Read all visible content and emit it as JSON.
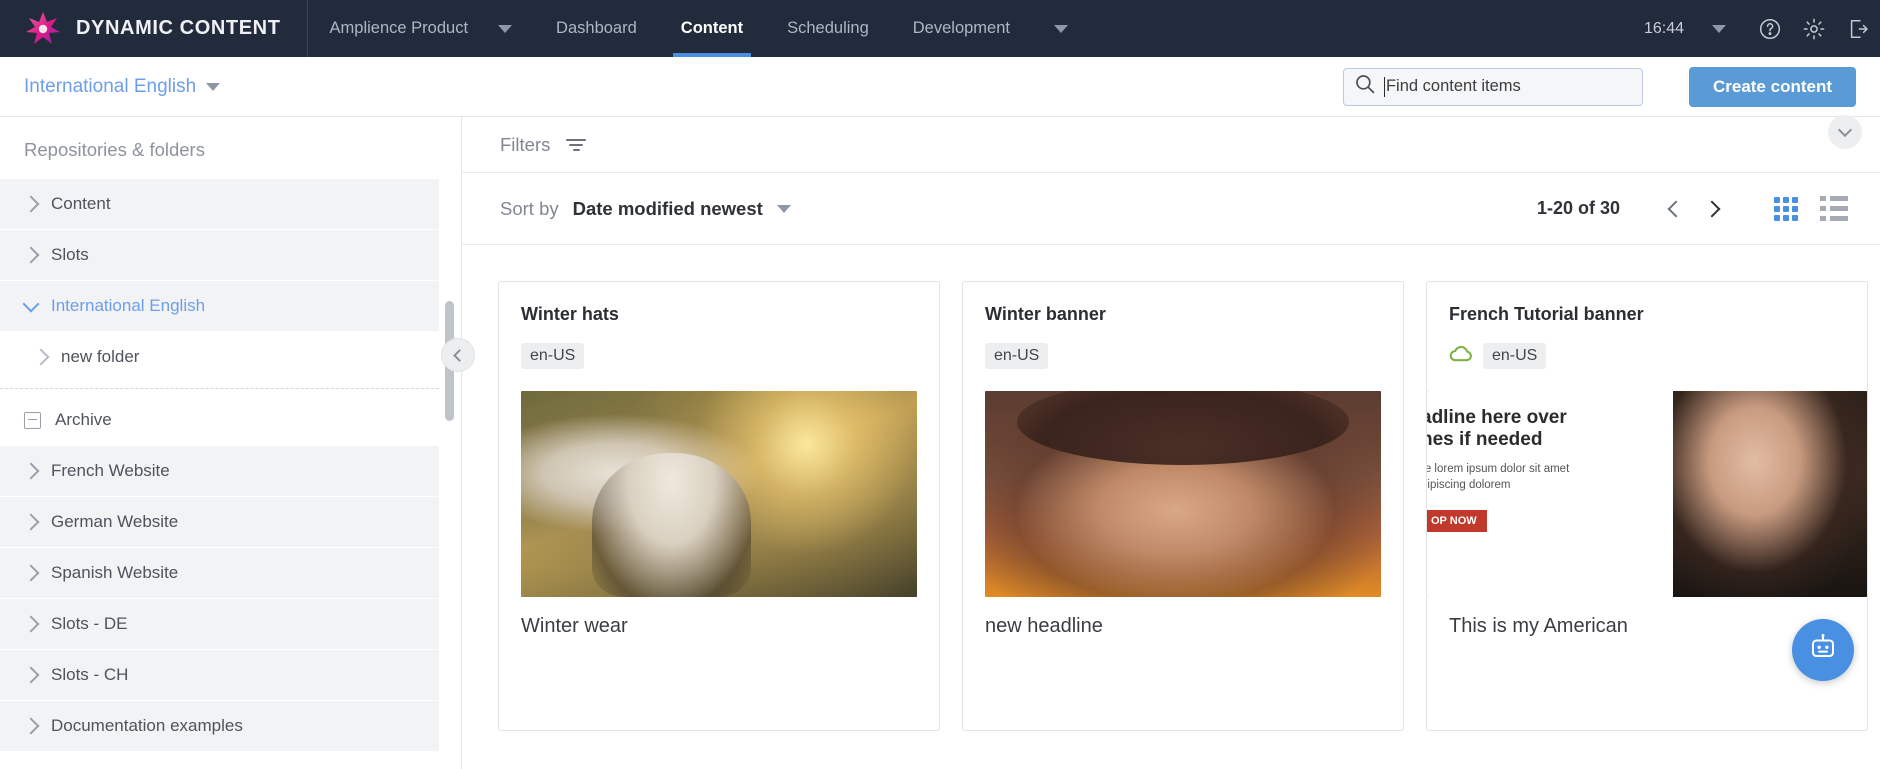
{
  "topnav": {
    "brand": "DYNAMIC CONTENT",
    "brand_logo_icon": "amplience-star-logo",
    "product_selector": "Amplience Product",
    "items": [
      {
        "label": "Dashboard",
        "active": false
      },
      {
        "label": "Content",
        "active": true
      },
      {
        "label": "Scheduling",
        "active": false
      },
      {
        "label": "Development",
        "active": false
      }
    ],
    "time": "16:44",
    "icons": [
      "help-icon",
      "gear-icon",
      "logout-icon"
    ]
  },
  "subheader": {
    "repository": "International English",
    "search": {
      "placeholder": "Find content items",
      "value": "",
      "icon": "search-icon"
    },
    "create_button": "Create content"
  },
  "sidebar": {
    "title": "Repositories & folders",
    "items": [
      {
        "label": "Content",
        "icon": "chevron-right-icon",
        "state": "collapsed",
        "selected": false,
        "child": false
      },
      {
        "label": "Slots",
        "icon": "chevron-right-icon",
        "state": "collapsed",
        "selected": false,
        "child": false
      },
      {
        "label": "International English",
        "icon": "chevron-down-icon",
        "state": "expanded",
        "selected": true,
        "child": false
      },
      {
        "label": "new folder",
        "icon": "chevron-right-icon",
        "state": "collapsed",
        "selected": false,
        "child": true
      },
      {
        "label": "Archive",
        "icon": "box-minus-icon",
        "state": "expanded",
        "selected": false,
        "child": false
      },
      {
        "label": "French Website",
        "icon": "chevron-right-icon",
        "state": "collapsed",
        "selected": false,
        "child": false
      },
      {
        "label": "German Website",
        "icon": "chevron-right-icon",
        "state": "collapsed",
        "selected": false,
        "child": false
      },
      {
        "label": "Spanish Website",
        "icon": "chevron-right-icon",
        "state": "collapsed",
        "selected": false,
        "child": false
      },
      {
        "label": "Slots - DE",
        "icon": "chevron-right-icon",
        "state": "collapsed",
        "selected": false,
        "child": false
      },
      {
        "label": "Slots - CH",
        "icon": "chevron-right-icon",
        "state": "collapsed",
        "selected": false,
        "child": false
      },
      {
        "label": "Documentation examples",
        "icon": "chevron-right-icon",
        "state": "collapsed",
        "selected": false,
        "child": false
      }
    ],
    "collapse_button_icon": "chevron-left-icon"
  },
  "main": {
    "filters_label": "Filters",
    "filter_icon": "filter-icon",
    "sort_label": "Sort by",
    "sort_value": "Date modified newest",
    "pagination": {
      "range": "1-20 of 30",
      "prev_icon": "chevron-left-icon",
      "next_icon": "chevron-right-icon"
    },
    "views": [
      {
        "name": "grid-view",
        "active": true
      },
      {
        "name": "list-view",
        "active": false
      }
    ],
    "expand_panel_icon": "chevron-down-icon",
    "chat_icon": "chat-bot-icon",
    "cards": [
      {
        "title": "Winter hats",
        "locale": "en-US",
        "published": false,
        "caption": "Winter wear",
        "image_alt": "woman-in-knit-hat-autumn"
      },
      {
        "title": "Winter banner",
        "locale": "en-US",
        "published": false,
        "caption": "new headline",
        "image_alt": "woman-in-wide-brim-hat"
      },
      {
        "title": "French Tutorial banner",
        "locale": "en-US",
        "published": true,
        "published_icon": "cloud-icon",
        "caption": "This is my American",
        "image_alt": "banner-with-headline-and-shop-now",
        "banner": {
          "headline": "adline here over\nnes if needed",
          "body": "re lorem ipsum dolor sit amet\ndipiscing dolorem",
          "cta": "OP NOW"
        }
      }
    ]
  },
  "colors": {
    "nav_bg": "#222b3c",
    "accent": "#4a90e2",
    "button": "#5b9bd5",
    "link": "#6d9eeb",
    "published_green": "#7cb342"
  }
}
